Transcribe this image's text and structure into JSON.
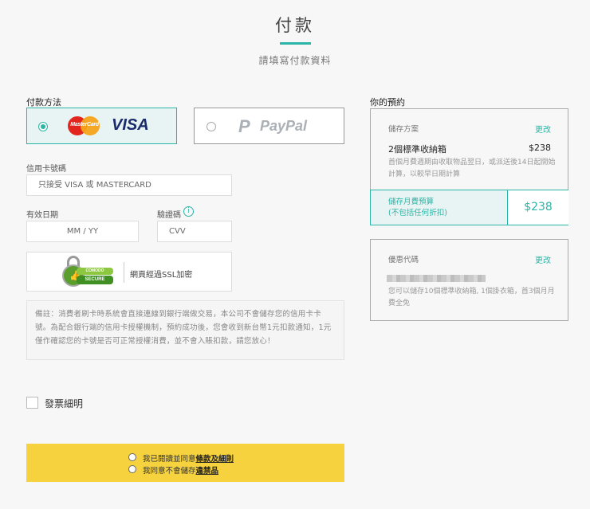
{
  "header": {
    "title": "付款",
    "subtitle": "請填寫付款資料"
  },
  "payment": {
    "section_label": "付款方法",
    "methods": [
      {
        "mastercard_text": "MasterCard",
        "visa_text": "VISA",
        "selected": true
      },
      {
        "paypal_text": "PayPal",
        "selected": false
      }
    ]
  },
  "card_form": {
    "number_label": "信用卡號碼",
    "number_placeholder": "只接受 VISA 或 MASTERCARD",
    "expiry_label": "有效日期",
    "expiry_placeholder": "MM  /  YY",
    "cvv_label": "驗證碼",
    "cvv_placeholder": "CVV",
    "info_glyph": "i"
  },
  "ssl": {
    "seal_top": "COMODO",
    "seal_bottom": "SECURE",
    "text": "網頁經過SSL加密"
  },
  "note": {
    "text": "備註：消費者刷卡時系統會直接連線到銀行端做交易，本公司不會儲存您的信用卡卡號。為配合銀行端的信用卡授權機制，預約成功後，您會收到新台幣1元扣款通知，1元僅作確認您的卡號是否可正常授權消費，並不會入賬扣款，請您放心！"
  },
  "invoice": {
    "label": "發票細明",
    "checked": false
  },
  "agreements": {
    "row1_prefix": "我已閱讀並同意",
    "row1_link": "條款及細則",
    "row2_prefix": "我同意不會儲存",
    "row2_link": "違禁品"
  },
  "order": {
    "section_label": "你的預約",
    "plan_label": "儲存方案",
    "edit_label": "更改",
    "item_name": "2個標準收納箱",
    "item_price": "$238",
    "item_desc": "首個月費週期由收取物品翌日，或派送後14日起開始計算，以較早日期計算",
    "total_label_line1": "儲存月費預算",
    "total_label_line2": "(不包括任何折扣)",
    "total_price": "$238"
  },
  "promo": {
    "label": "優惠代碼",
    "edit_label": "更改",
    "desc": "您可以儲存10個標準收納箱, 1個掛衣箱，首3個月月費全免"
  },
  "colors": {
    "accent": "#2bb5a6",
    "agree_bg": "#f5d23e",
    "visa_blue": "#1a2b6d",
    "mc_red": "#e3261d",
    "mc_yellow": "#f6a21a"
  }
}
